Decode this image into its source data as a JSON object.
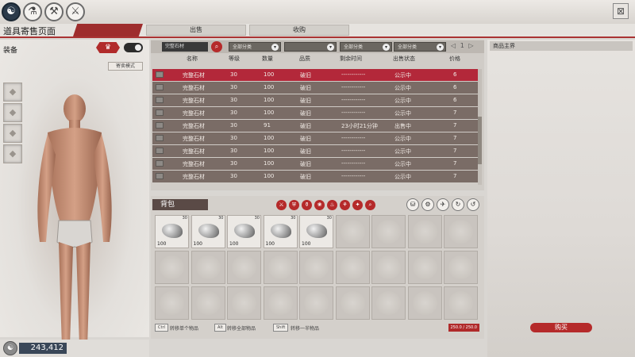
{
  "top_icons": [
    "☯",
    "⚗",
    "⚒",
    "⚔"
  ],
  "close_icon": "⊠",
  "page_title": "道具寄售页面",
  "tabs": [
    "出售",
    "收购"
  ],
  "equipment": {
    "label": "装备",
    "emblem": "♛",
    "mode_button": "寄卖模式"
  },
  "market": {
    "search_value": "完整石材",
    "search_icon": "⌕",
    "dropdowns": [
      "全部分类",
      "",
      "全部分类",
      "全部分类"
    ],
    "pager": {
      "prev": "◁",
      "page": "1",
      "next": "▷"
    },
    "columns": [
      "名称",
      "等级",
      "数量",
      "品质",
      "剩余时间",
      "出售状态",
      "价格"
    ],
    "rows": [
      {
        "name": "完整石材",
        "level": "30",
        "qty": "100",
        "quality": "破旧",
        "time": "------------",
        "status": "公示中",
        "price": "6"
      },
      {
        "name": "完整石材",
        "level": "30",
        "qty": "100",
        "quality": "破旧",
        "time": "------------",
        "status": "公示中",
        "price": "6"
      },
      {
        "name": "完整石材",
        "level": "30",
        "qty": "100",
        "quality": "破旧",
        "time": "------------",
        "status": "公示中",
        "price": "6"
      },
      {
        "name": "完整石材",
        "level": "30",
        "qty": "100",
        "quality": "破旧",
        "time": "------------",
        "status": "公示中",
        "price": "7"
      },
      {
        "name": "完整石材",
        "level": "30",
        "qty": "91",
        "quality": "破旧",
        "time": "23小时21分钟",
        "status": "出售中",
        "price": "7"
      },
      {
        "name": "完整石材",
        "level": "30",
        "qty": "100",
        "quality": "破旧",
        "time": "------------",
        "status": "公示中",
        "price": "7"
      },
      {
        "name": "完整石材",
        "level": "30",
        "qty": "100",
        "quality": "破旧",
        "time": "------------",
        "status": "公示中",
        "price": "7"
      },
      {
        "name": "完整石材",
        "level": "30",
        "qty": "100",
        "quality": "破旧",
        "time": "------------",
        "status": "公示中",
        "price": "7"
      },
      {
        "name": "完整石材",
        "level": "30",
        "qty": "100",
        "quality": "破旧",
        "time": "------------",
        "status": "公示中",
        "price": "7"
      }
    ]
  },
  "bag": {
    "title": "背包",
    "filter_icons": [
      "⚔",
      "⛨",
      "⚱",
      "❀",
      "♨",
      "⚘",
      "✦",
      "⌕"
    ],
    "tool_icons": [
      "⛁",
      "⚙",
      "✈",
      "↻",
      "↺"
    ],
    "items": [
      {
        "tag": "30",
        "qty": "100"
      },
      {
        "tag": "30",
        "qty": "100"
      },
      {
        "tag": "30",
        "qty": "100"
      },
      {
        "tag": "30",
        "qty": "100"
      },
      {
        "tag": "30",
        "qty": "100"
      }
    ],
    "hints": [
      {
        "key": "Ctrl",
        "text": "转移单个物品"
      },
      {
        "key": "Alt",
        "text": "转移全部物品"
      },
      {
        "key": "Shift",
        "text": "转移一半物品"
      }
    ],
    "capacity": "250.0 / 250.0"
  },
  "currency": {
    "icon": "☯",
    "amount": "243,412"
  },
  "right_panel": {
    "title": "商品主界",
    "buy_label": "购买"
  }
}
